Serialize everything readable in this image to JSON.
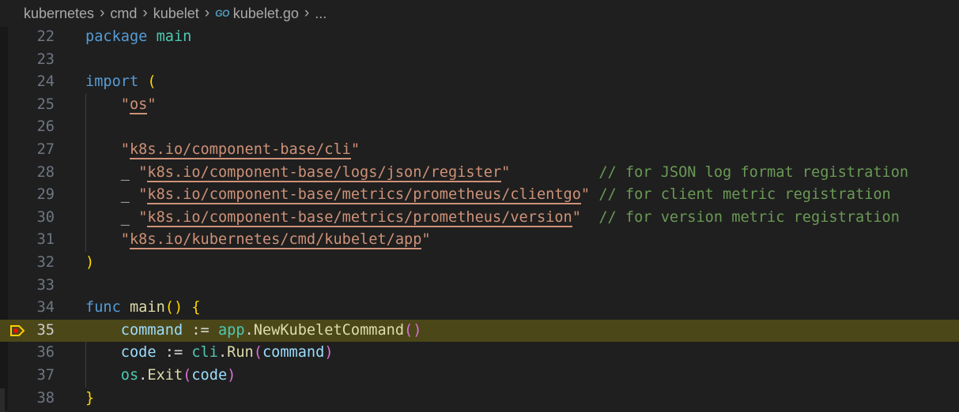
{
  "breadcrumb": {
    "items": [
      "kubernetes",
      "cmd",
      "kubelet"
    ],
    "file_icon": "GO",
    "file": "kubelet.go",
    "more": "..."
  },
  "editor": {
    "highlighted_line": 35,
    "breakpoint_line": 35,
    "lines": [
      {
        "n": "22",
        "tokens": [
          [
            "kw",
            "package"
          ],
          [
            "op",
            " "
          ],
          [
            "pkg",
            "main"
          ]
        ]
      },
      {
        "n": "23",
        "tokens": []
      },
      {
        "n": "24",
        "tokens": [
          [
            "kw",
            "import"
          ],
          [
            "op",
            " "
          ],
          [
            "p1",
            "("
          ]
        ]
      },
      {
        "n": "25",
        "tokens": [
          [
            "op",
            "    "
          ],
          [
            "str",
            "\"os\""
          ]
        ]
      },
      {
        "n": "26",
        "tokens": []
      },
      {
        "n": "27",
        "tokens": [
          [
            "op",
            "    "
          ],
          [
            "str",
            "\"k8s.io/component-base/cli\""
          ]
        ]
      },
      {
        "n": "28",
        "tokens": [
          [
            "op",
            "    "
          ],
          [
            "op",
            "_"
          ],
          [
            "op",
            " "
          ],
          [
            "str",
            "\"k8s.io/component-base/logs/json/register\""
          ],
          [
            "op",
            "          "
          ],
          [
            "cm",
            "// for JSON log format registration"
          ]
        ]
      },
      {
        "n": "29",
        "tokens": [
          [
            "op",
            "    "
          ],
          [
            "op",
            "_"
          ],
          [
            "op",
            " "
          ],
          [
            "str",
            "\"k8s.io/component-base/metrics/prometheus/clientgo\""
          ],
          [
            "op",
            " "
          ],
          [
            "cm",
            "// for client metric registration"
          ]
        ]
      },
      {
        "n": "30",
        "tokens": [
          [
            "op",
            "    "
          ],
          [
            "op",
            "_"
          ],
          [
            "op",
            " "
          ],
          [
            "str",
            "\"k8s.io/component-base/metrics/prometheus/version\""
          ],
          [
            "op",
            "  "
          ],
          [
            "cm",
            "// for version metric registration"
          ]
        ]
      },
      {
        "n": "31",
        "tokens": [
          [
            "op",
            "    "
          ],
          [
            "str",
            "\"k8s.io/kubernetes/cmd/kubelet/app\""
          ]
        ]
      },
      {
        "n": "32",
        "tokens": [
          [
            "p1",
            ")"
          ]
        ]
      },
      {
        "n": "33",
        "tokens": []
      },
      {
        "n": "34",
        "tokens": [
          [
            "kw",
            "func"
          ],
          [
            "op",
            " "
          ],
          [
            "fn",
            "main"
          ],
          [
            "p1",
            "()"
          ],
          [
            "op",
            " "
          ],
          [
            "p1",
            "{"
          ]
        ]
      },
      {
        "n": "35",
        "tokens": [
          [
            "op",
            "    "
          ],
          [
            "var",
            "command"
          ],
          [
            "op",
            " := "
          ],
          [
            "pkg",
            "app"
          ],
          [
            "op",
            "."
          ],
          [
            "fn",
            "NewKubeletCommand"
          ],
          [
            "p2",
            "()"
          ]
        ]
      },
      {
        "n": "36",
        "tokens": [
          [
            "op",
            "    "
          ],
          [
            "var",
            "code"
          ],
          [
            "op",
            " := "
          ],
          [
            "pkg",
            "cli"
          ],
          [
            "op",
            "."
          ],
          [
            "fn",
            "Run"
          ],
          [
            "p2",
            "("
          ],
          [
            "var",
            "command"
          ],
          [
            "p2",
            ")"
          ]
        ]
      },
      {
        "n": "37",
        "tokens": [
          [
            "op",
            "    "
          ],
          [
            "pkg",
            "os"
          ],
          [
            "op",
            "."
          ],
          [
            "fn",
            "Exit"
          ],
          [
            "p2",
            "("
          ],
          [
            "var",
            "code"
          ],
          [
            "p2",
            ")"
          ]
        ]
      },
      {
        "n": "38",
        "tokens": [
          [
            "p1",
            "}"
          ]
        ]
      }
    ]
  }
}
